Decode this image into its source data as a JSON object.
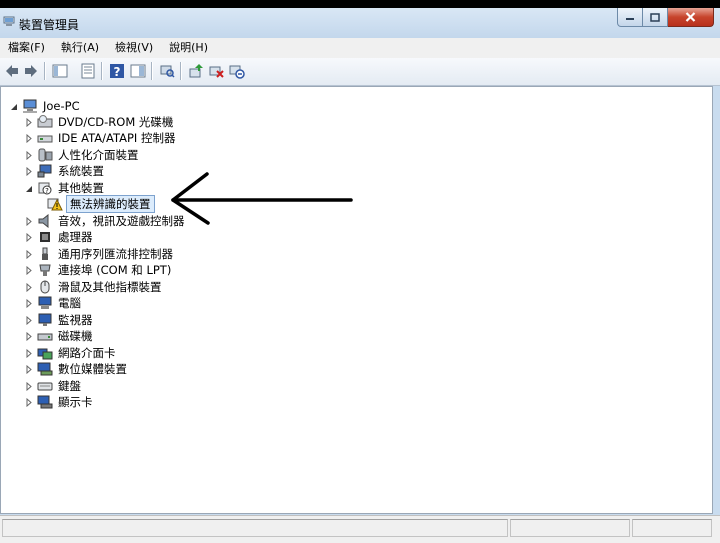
{
  "window": {
    "title": "裝置管理員"
  },
  "menu": [
    {
      "id": "file",
      "label": "檔案(F)"
    },
    {
      "id": "action",
      "label": "執行(A)"
    },
    {
      "id": "view",
      "label": "檢視(V)"
    },
    {
      "id": "help",
      "label": "說明(H)"
    }
  ],
  "toolbar": {
    "buttons": [
      "back-icon",
      "forward-icon",
      "show-hide-tree-icon",
      "properties-icon",
      "help-icon",
      "console-tree-icon",
      "scan-hardware-icon",
      "update-driver-icon",
      "uninstall-icon",
      "disable-icon"
    ]
  },
  "tree": {
    "root": "Joe-PC",
    "categories": [
      {
        "label": "DVD/CD-ROM 光碟機",
        "icon": "dvd-drive-icon"
      },
      {
        "label": "IDE ATA/ATAPI 控制器",
        "icon": "ide-controller-icon"
      },
      {
        "label": "人性化介面裝置",
        "icon": "hid-icon"
      },
      {
        "label": "系統裝置",
        "icon": "system-device-icon"
      },
      {
        "label": "其他裝置",
        "icon": "other-device-icon",
        "expanded": true,
        "children": [
          {
            "label": "無法辨識的裝置",
            "icon": "warning-device-icon"
          }
        ]
      },
      {
        "label": "音效，視訊及遊戲控制器",
        "icon": "speaker-icon"
      },
      {
        "label": "處理器",
        "icon": "processor-icon"
      },
      {
        "label": "通用序列匯流排控制器",
        "icon": "usb-icon"
      },
      {
        "label": "連接埠 (COM 和 LPT)",
        "icon": "port-icon"
      },
      {
        "label": "滑鼠及其他指標裝置",
        "icon": "mouse-icon"
      },
      {
        "label": "電腦",
        "icon": "computer-icon"
      },
      {
        "label": "監視器",
        "icon": "monitor-icon"
      },
      {
        "label": "磁碟機",
        "icon": "disk-drive-icon"
      },
      {
        "label": "網路介面卡",
        "icon": "network-adapter-icon"
      },
      {
        "label": "數位媒體裝置",
        "icon": "digital-media-icon"
      },
      {
        "label": "鍵盤",
        "icon": "keyboard-icon"
      },
      {
        "label": "顯示卡",
        "icon": "display-adapter-icon"
      }
    ]
  },
  "colors": {
    "titlebar": "#c9dcef",
    "selection": "#dcecfc",
    "close": "#c7442c"
  }
}
